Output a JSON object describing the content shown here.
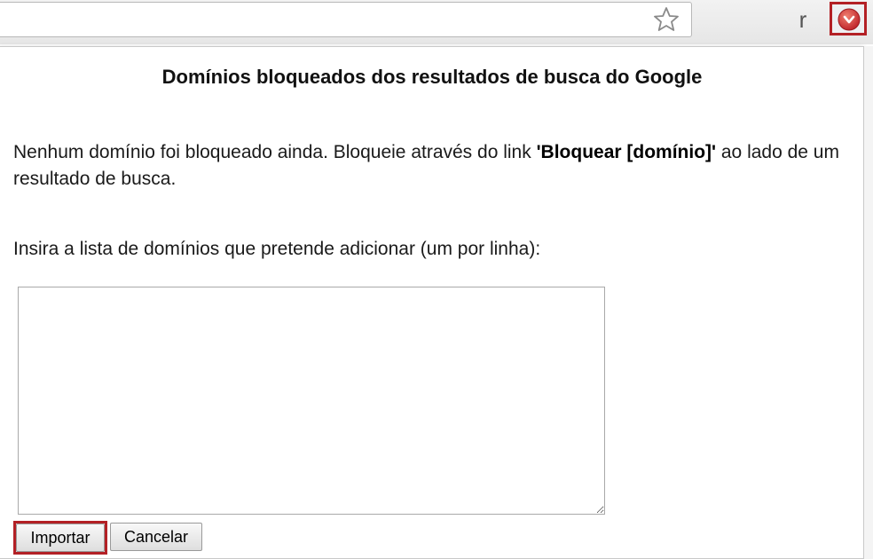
{
  "toolbar": {
    "bookmark_icon": "star-outline-icon",
    "extension_letter": "r",
    "blocklist_extension_icon": "red-circle-down-icon",
    "highlight_color": "#b32025"
  },
  "popup": {
    "title": "Domínios bloqueados dos resultados de busca do Google",
    "message_part1": "Nenhum domínio foi bloqueado ainda. Bloqueie através do link ",
    "message_link": "'Bloquear [domínio]'",
    "message_part2": " ao lado de um resultado de busca.",
    "import_label": "Insira a lista de domínios que pretende adicionar (um por linha):",
    "textarea_value": "",
    "import_button": "Importar",
    "cancel_button": "Cancelar"
  }
}
